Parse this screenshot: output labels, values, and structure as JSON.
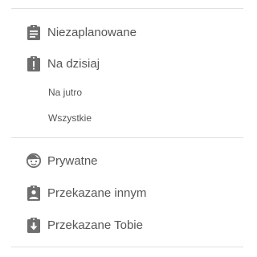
{
  "colors": {
    "icon": "#6e6e6e",
    "text": "#555555",
    "divider": "#e0e0e0"
  },
  "menu": {
    "group1": [
      {
        "label": "Niezaplanowane",
        "icon": "clipboard-list-icon"
      },
      {
        "label": "Na dzisiaj",
        "icon": "clipboard-alert-icon"
      }
    ],
    "sub": [
      {
        "label": "Na jutro"
      },
      {
        "label": "Wszystkie"
      }
    ],
    "group2": [
      {
        "label": "Prywatne",
        "icon": "face-icon"
      },
      {
        "label": "Przekazane innym",
        "icon": "clipboard-account-icon"
      },
      {
        "label": "Przekazane Tobie",
        "icon": "clipboard-arrow-down-icon"
      }
    ]
  }
}
